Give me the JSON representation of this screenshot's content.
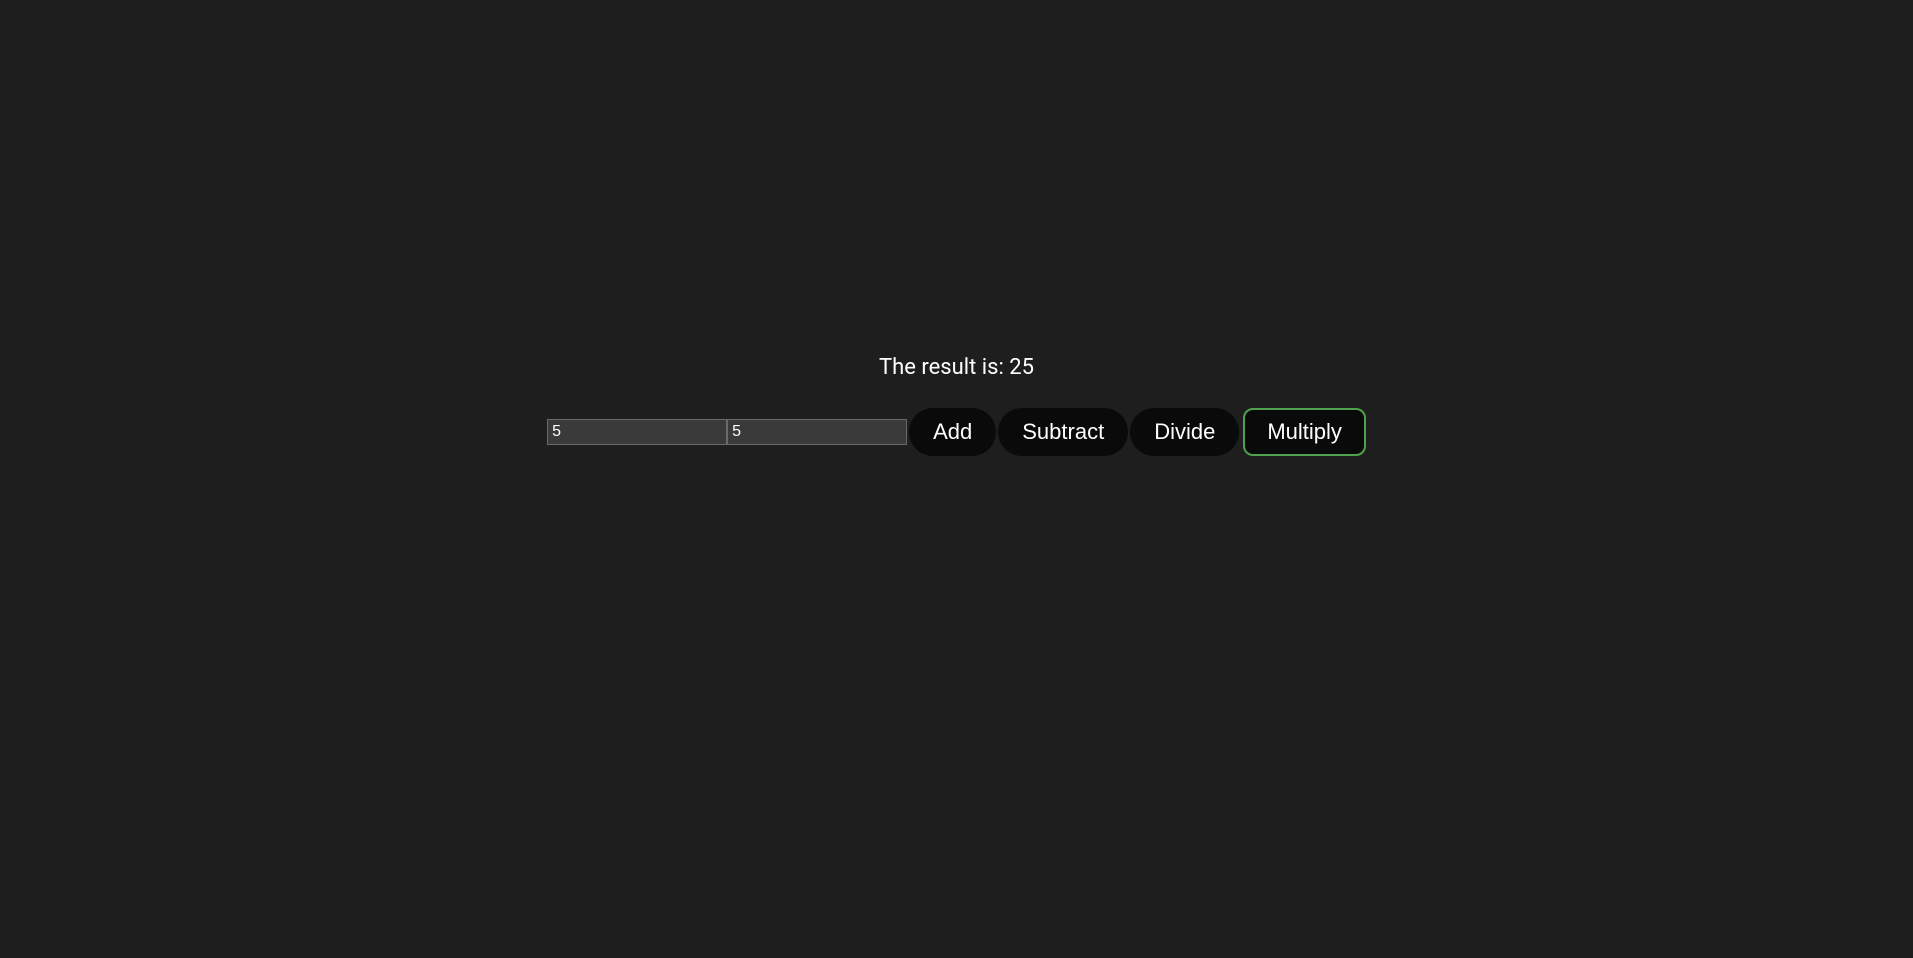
{
  "result": {
    "label": "The result is: ",
    "value": "25"
  },
  "inputs": {
    "first": {
      "value": "5",
      "placeholder": ""
    },
    "second": {
      "value": "5",
      "placeholder": ""
    }
  },
  "buttons": {
    "add": "Add",
    "subtract": "Subtract",
    "divide": "Divide",
    "multiply": "Multiply"
  }
}
